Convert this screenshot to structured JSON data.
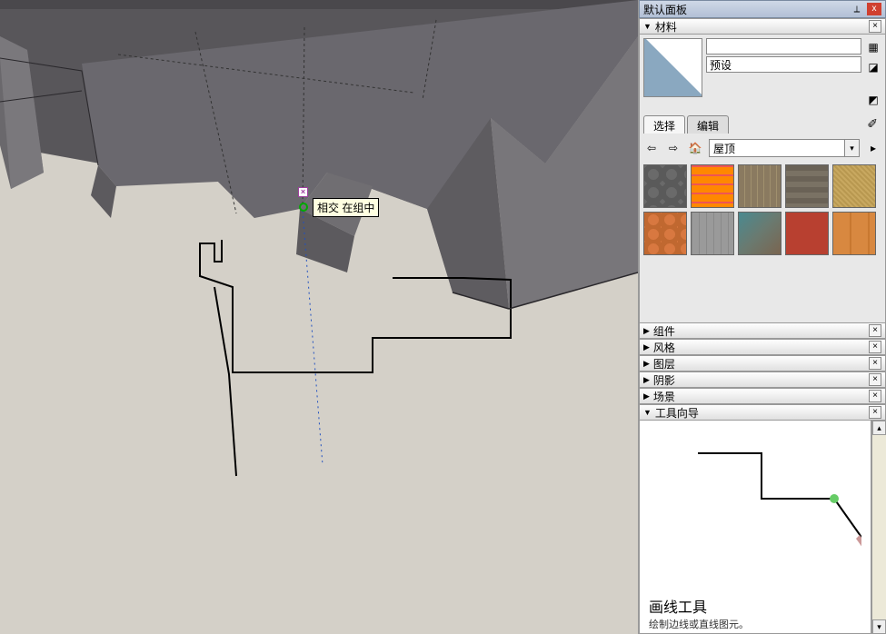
{
  "panel": {
    "title": "默认面板",
    "sections": {
      "materials": {
        "label": "材料",
        "preset_label": "预设",
        "tabs": {
          "select": "选择",
          "edit": "编辑"
        },
        "category": "屋顶"
      },
      "components": "组件",
      "styles": "风格",
      "layers": "图层",
      "shadows": "阴影",
      "scenes": "场景",
      "instructor": "工具向导"
    }
  },
  "viewport": {
    "tooltip": "相交 在组中"
  },
  "instructor": {
    "tool_name": "画线工具",
    "tool_desc": "绘制边线或直线图元。"
  },
  "icons": {
    "pin": "📌",
    "close": "x",
    "collapse": "×",
    "add_mat": "✚",
    "cube": "◩",
    "back": "⇦",
    "fwd": "⇨",
    "home": "⌂",
    "details": "➧",
    "eyedrop": "✎"
  },
  "chart_data": null
}
